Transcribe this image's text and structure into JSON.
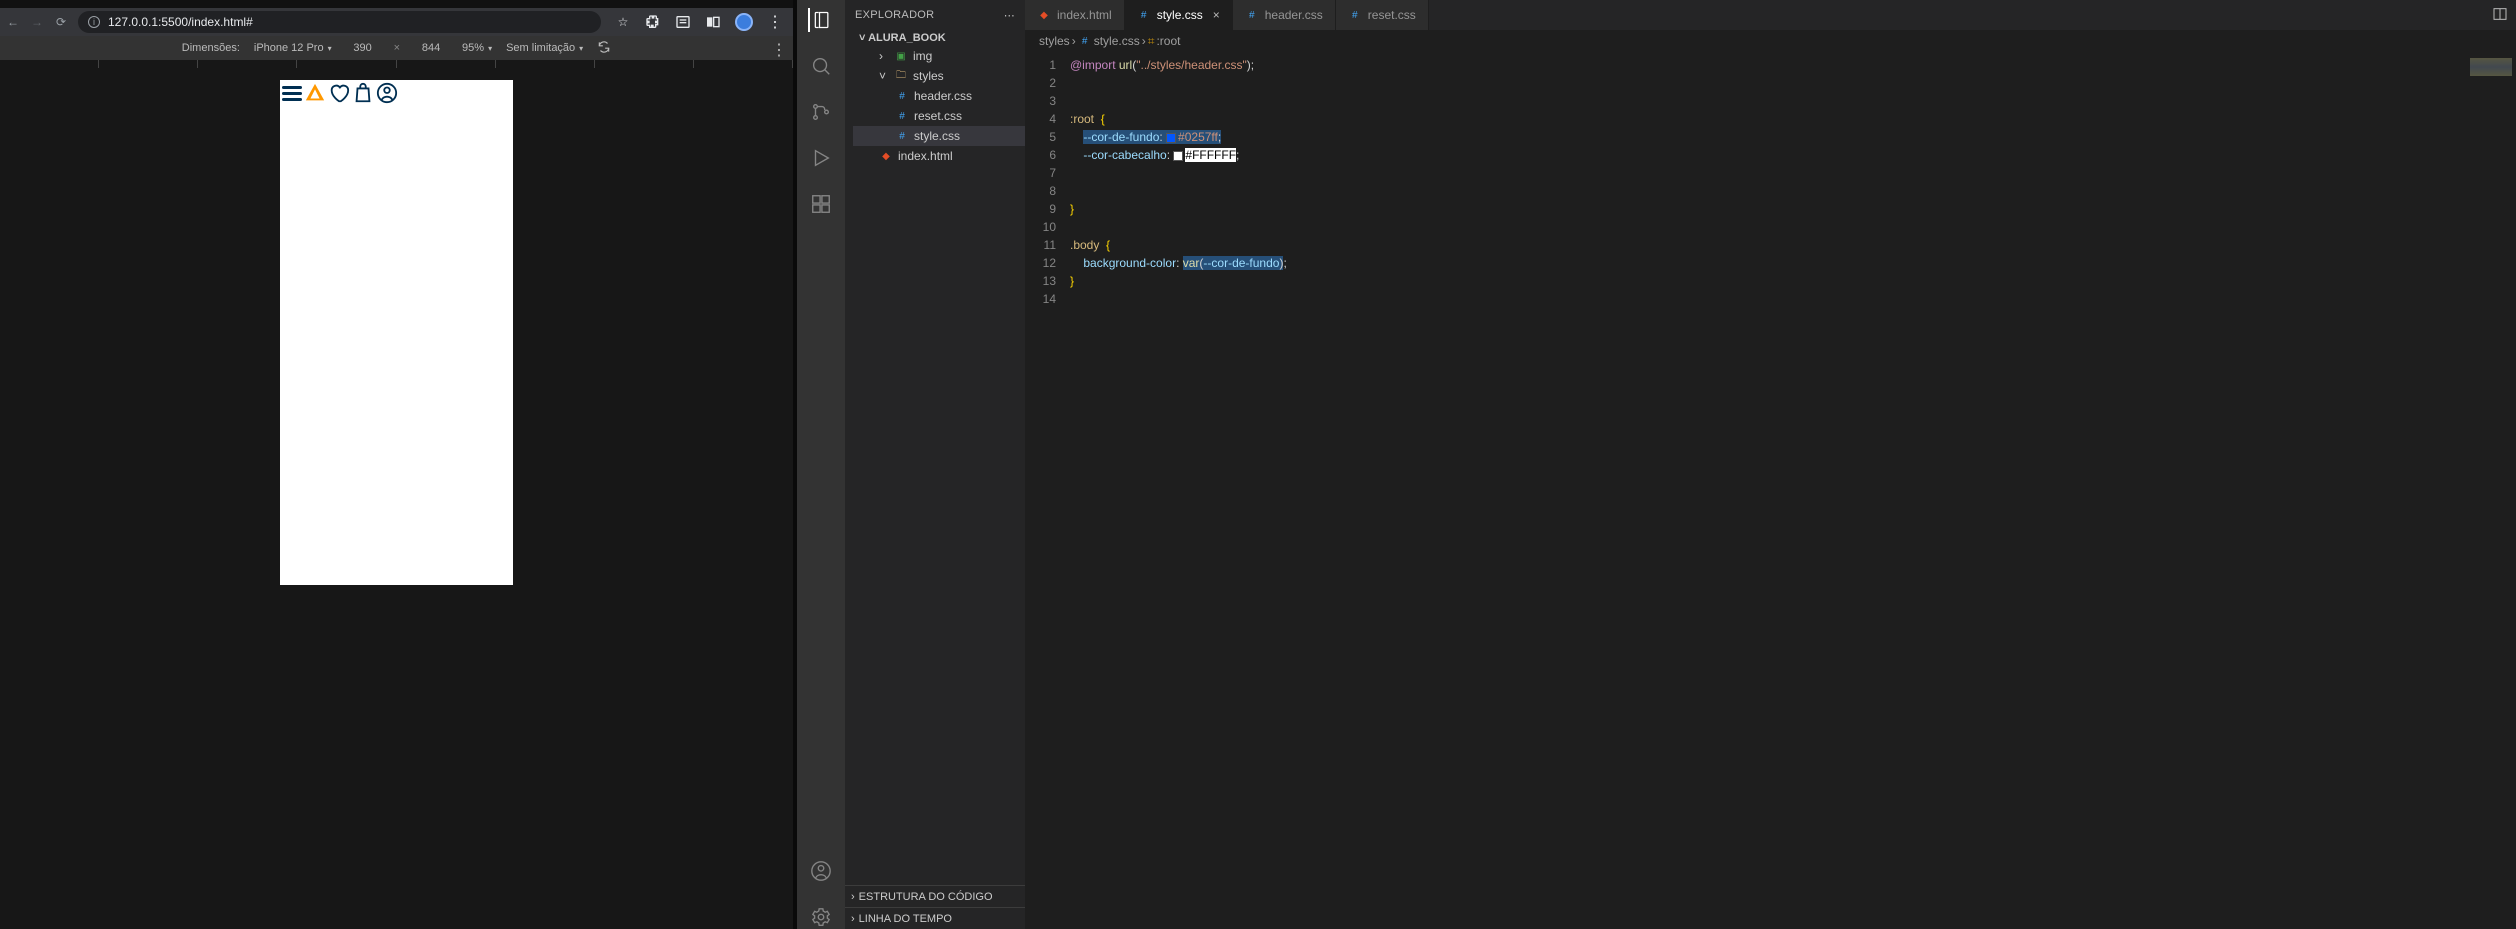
{
  "browser": {
    "url": "127.0.0.1:5500/index.html#",
    "device_bar": {
      "label": "Dimensões:",
      "device": "iPhone 12 Pro",
      "width": "390",
      "height": "844",
      "zoom": "95%",
      "throttle": "Sem limitação"
    }
  },
  "vscode": {
    "explorer_title": "EXPLORADOR",
    "project": "ALURA_BOOK",
    "tree": {
      "img": "img",
      "styles": "styles",
      "header": "header.css",
      "reset": "reset.css",
      "style": "style.css",
      "index": "index.html"
    },
    "side_sections": {
      "outline": "ESTRUTURA DO CÓDIGO",
      "timeline": "LINHA DO TEMPO"
    },
    "tabs": {
      "index": "index.html",
      "style": "style.css",
      "header": "header.css",
      "reset": "reset.css"
    },
    "breadcrumb": {
      "folder": "styles",
      "file": "style.css",
      "symbol": ":root"
    },
    "code": {
      "l1_at": "@import",
      "l1_fn": "url",
      "l1_str": "\"../styles/header.css\"",
      "l4_sel": ":root",
      "l5_prop": "--cor-de-fundo",
      "l5_val": "#0257ff",
      "l6_prop": "--cor-cabecalho",
      "l6_val": "#FFFFFF",
      "l11_sel": ".body",
      "l12_prop": "background-color",
      "l12_fn": "var",
      "l12_var": "--cor-de-fundo"
    },
    "colors": {
      "blue": "#0257ff",
      "white": "#FFFFFF"
    },
    "line_numbers": [
      "1",
      "2",
      "3",
      "4",
      "5",
      "6",
      "7",
      "8",
      "9",
      "10",
      "11",
      "12",
      "13",
      "14"
    ]
  }
}
